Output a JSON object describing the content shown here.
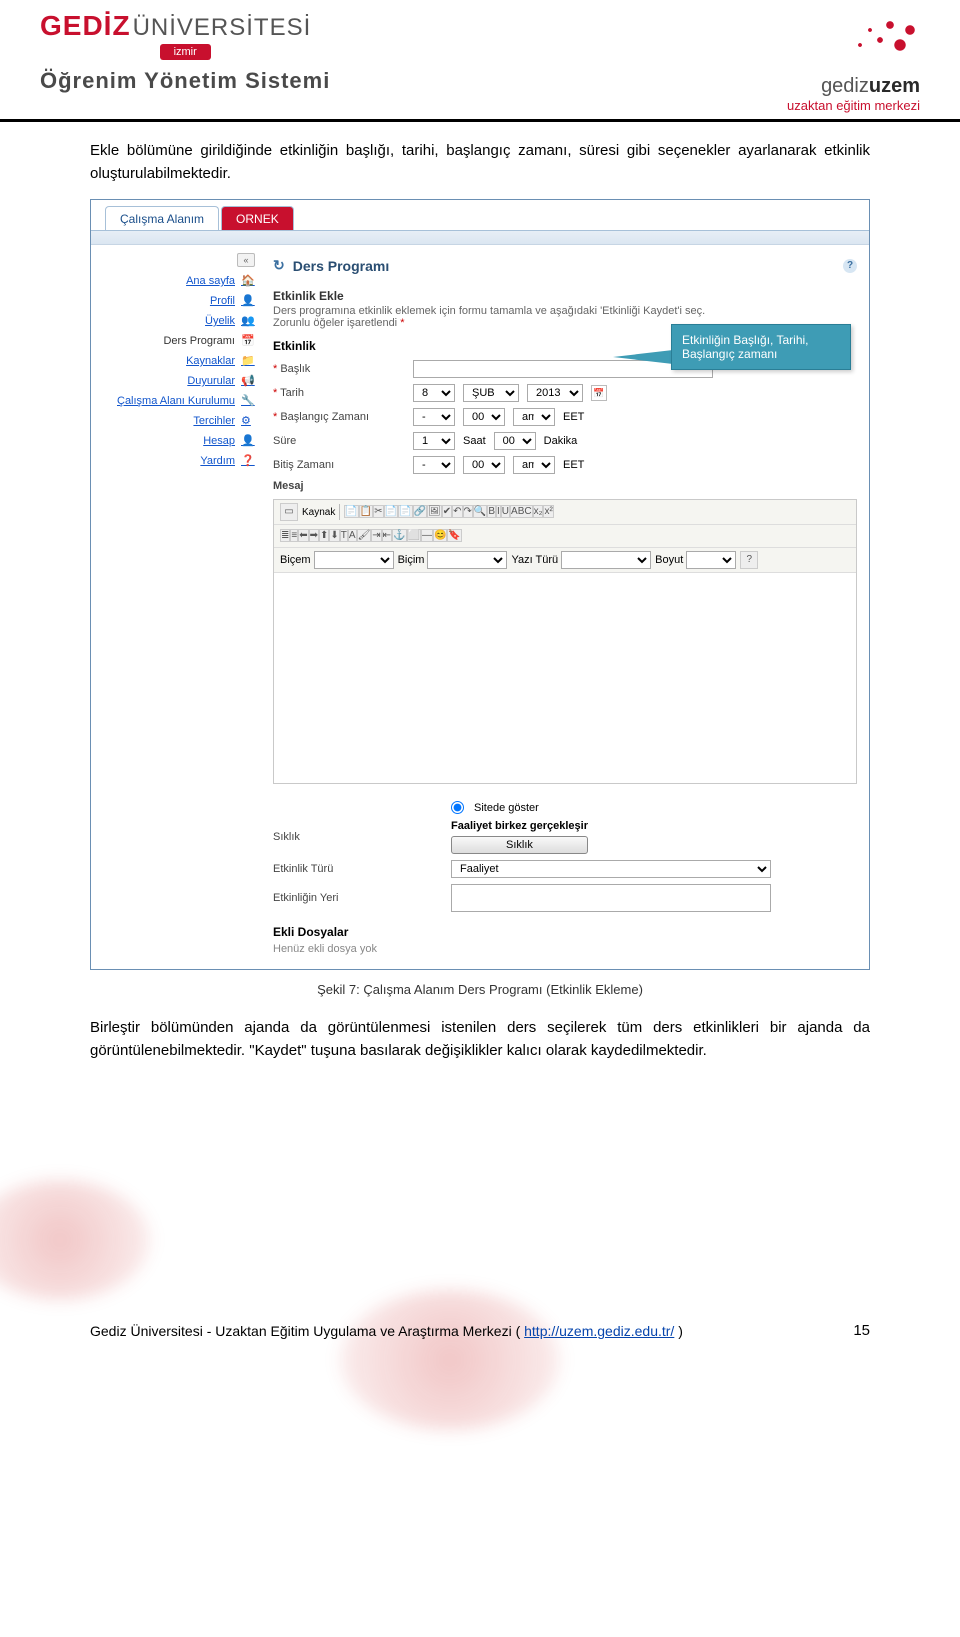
{
  "header": {
    "brand_a": "GEDİZ",
    "brand_b": "ÜNİVERSİTESİ",
    "izmir": "izmir",
    "system": "Öğrenim Yönetim Sistemi",
    "uzem_a": "gediz",
    "uzem_b": "uzem",
    "uzem_sub": "uzaktan eğitim merkezi"
  },
  "para1": "Ekle bölümüne girildiğinde etkinliğin başlığı, tarihi, başlangıç zamanı, süresi gibi seçenekler ayarlanarak etkinlik oluşturulabilmektedir.",
  "tabs": {
    "active": "Çalışma Alanım",
    "inactive": "ORNEK"
  },
  "sidebar": {
    "collapse": "«",
    "items": [
      {
        "label": "Ana sayfa",
        "link": true,
        "icon": "home"
      },
      {
        "label": "Profil",
        "link": true,
        "icon": "user"
      },
      {
        "label": "Üyelik",
        "link": true,
        "icon": "group"
      },
      {
        "label": "Ders Programı",
        "link": false,
        "icon": "calendar"
      },
      {
        "label": "Kaynaklar",
        "link": true,
        "icon": "folder"
      },
      {
        "label": "Duyurular",
        "link": true,
        "icon": "horn"
      },
      {
        "label": "Çalışma Alanı Kurulumu",
        "link": true,
        "icon": "wrench"
      },
      {
        "label": "Tercihler",
        "link": true,
        "icon": "gear"
      },
      {
        "label": "Hesap",
        "link": true,
        "icon": "person"
      },
      {
        "label": "Yardım",
        "link": true,
        "icon": "help"
      }
    ]
  },
  "main": {
    "title": "Ders Programı",
    "subtitle": "Etkinlik Ekle",
    "instr": "Ders programına etkinlik eklemek için formu tamamla ve aşağıdaki 'Etkinliği Kaydet'i seç.",
    "required": "Zorunlu öğeler işaretlendi",
    "star": "*",
    "section_head": "Etkinlik",
    "rows": {
      "baslik": "Başlık",
      "tarih": "Tarih",
      "baslangic": "Başlangıç Zamanı",
      "sure": "Süre",
      "bitis": "Bitiş Zamanı",
      "mesaj": "Mesaj"
    },
    "tarih_vals": {
      "day": "8",
      "month": "ŞUB",
      "year": "2013"
    },
    "baslangic_vals": {
      "h": "-",
      "m": "00",
      "ap": "am",
      "tz": "EET"
    },
    "sure_vals": {
      "n": "1",
      "unit1": "Saat",
      "m": "00",
      "unit2": "Dakika"
    },
    "bitis_vals": {
      "h": "-",
      "m": "00",
      "ap": "am",
      "tz": "EET"
    },
    "editor": {
      "kaynak": "Kaynak",
      "row1": [
        "📄",
        "📋",
        "✂",
        "📄",
        "📄",
        "🔗",
        "🖼",
        "✔",
        "↶",
        "↷",
        "🔍",
        "B",
        "I",
        "U",
        "ABC",
        "x₂",
        "x²"
      ],
      "row2": [
        "≣",
        "≡",
        "⬅",
        "➡",
        "⬆",
        "⬇",
        "T",
        "A",
        "🖌",
        "⇥",
        "⇤",
        "⚓",
        "⬜",
        "—",
        "😊",
        "🔖"
      ],
      "labels": {
        "bicem": "Biçem",
        "bicim": "Biçim",
        "yazi": "Yazı Türü",
        "boyut": "Boyut"
      }
    },
    "lower": {
      "show_site": "Sitede göster",
      "siklik": "Sıklık",
      "faaliyet_once": "Faaliyet birkez gerçekleşir",
      "siklik_btn": "Sıklık",
      "etkinlik_turu": "Etkinlik Türü",
      "etkinlik_turu_val": "Faaliyet",
      "etkinlik_yeri": "Etkinliğin Yeri",
      "ekli_dosyalar": "Ekli Dosyalar",
      "henuz": "Henüz ekli dosya yok"
    }
  },
  "callout": {
    "l1": "Etkinliğin Başlığı, Tarihi,",
    "l2": "Başlangıç zamanı"
  },
  "caption": "Şekil 7: Çalışma Alanım Ders Programı (Etkinlik Ekleme)",
  "para2": "Birleştir bölümünden ajanda da görüntülenmesi istenilen ders seçilerek tüm ders etkinlikleri bir ajanda da görüntülenebilmektedir. \"Kaydet\" tuşuna basılarak değişiklikler kalıcı olarak kaydedilmektedir.",
  "footer": {
    "text_a": "Gediz Üniversitesi - Uzaktan Eğitim Uygulama ve Araştırma Merkezi  ( ",
    "link": "http://uzem.gediz.edu.tr/",
    "text_b": " )",
    "page": "15"
  }
}
